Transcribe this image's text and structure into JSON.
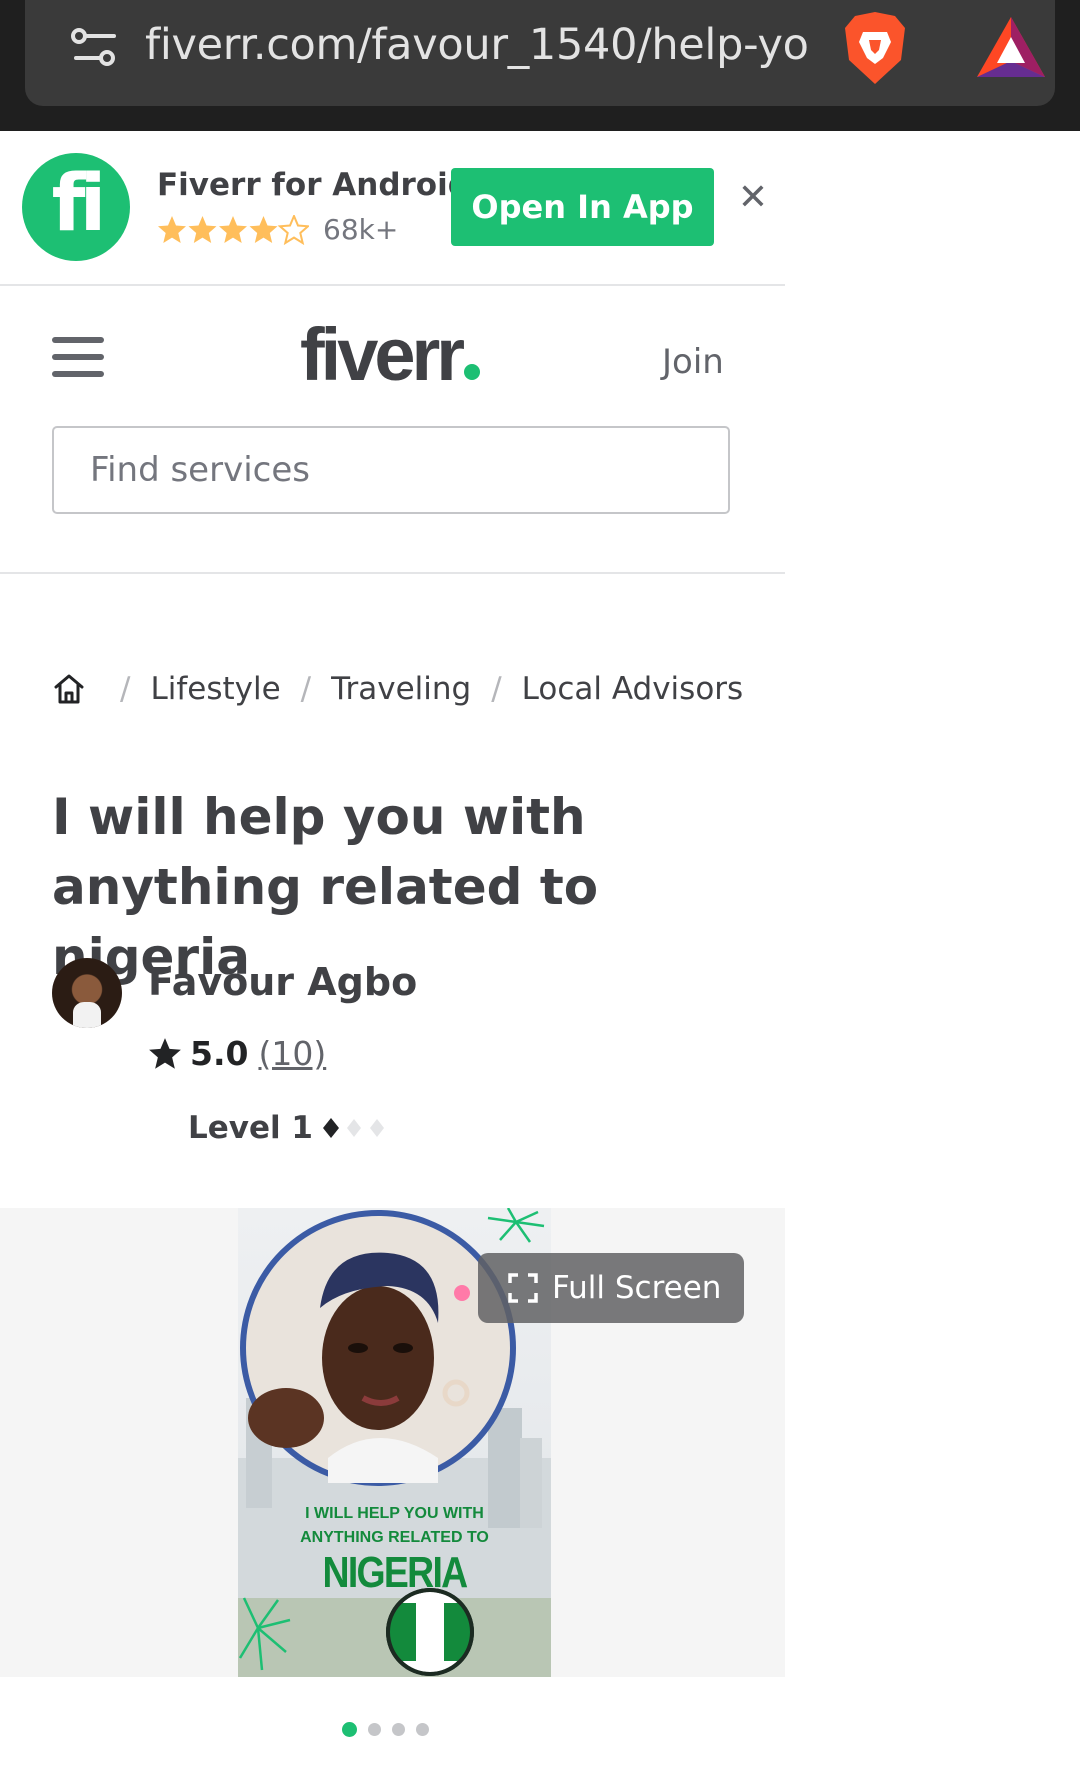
{
  "browser": {
    "url": "fiverr.com/favour_1540/help-yo"
  },
  "app_banner": {
    "name": "Fiverr for Android",
    "rating_count": "68k+",
    "open_label": "Open In App",
    "close_label": "✕",
    "logo_text": "fi",
    "stars": 4.5
  },
  "header": {
    "logo": "fiverr",
    "join_label": "Join",
    "search_placeholder": "Find services"
  },
  "breadcrumb": {
    "items": [
      "Lifestyle",
      "Traveling",
      "Local Advisors"
    ]
  },
  "gig": {
    "title": "I will help you with anything related to nigeria",
    "seller_name": "Favour Agbo",
    "rating": "5.0",
    "reviews": "(10)",
    "level": "Level 1",
    "image_text": {
      "line1": "I WILL HELP YOU WITH",
      "line2": "ANYTHING RELATED TO",
      "country": "NIGERIA"
    }
  },
  "gallery": {
    "fullscreen_label": "Full Screen",
    "slide_count": 4,
    "active_slide": 1
  },
  "colors": {
    "brand_green": "#1dbf73",
    "text": "#404145",
    "star_yellow": "#ffbe5b"
  }
}
